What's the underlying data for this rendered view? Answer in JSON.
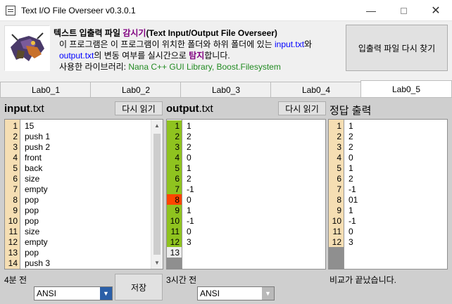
{
  "window": {
    "title": "Text I/O File Overseer v0.3.0.1"
  },
  "header": {
    "line1_a": "텍스트 입출력 파일 ",
    "line1_b": "감시기",
    "line1_c": "(Text Input/Output File Overseer)",
    "line2_a": "이 프로그램은 이 프로그램이 위치한 폴더와 하위 폴더에 있는 ",
    "line2_b": "input.txt",
    "line2_c": "와",
    "line3_a": "output.txt",
    "line3_b": "의 변동 여부를 실시간으로 ",
    "line3_c": "탐지",
    "line3_d": "합니다.",
    "line4_a": "사용한 라이브러리: ",
    "line4_b": "Nana C++ GUI Library, Boost.Filesystem",
    "refind_button": "입출력 파일 다시 찾기"
  },
  "tabs": [
    "Lab0_1",
    "Lab0_2",
    "Lab0_3",
    "Lab0_4",
    "Lab0_5"
  ],
  "active_tab": "Lab0_5",
  "input": {
    "label_bold": "input",
    "label_ext": ".txt",
    "reload_button": "다시 읽기",
    "line_numbers": [
      "1",
      "2",
      "3",
      "4",
      "5",
      "6",
      "7",
      "8",
      "9",
      "10",
      "11",
      "12",
      "13",
      "14"
    ],
    "lines": [
      "15",
      "push 1",
      "push 2",
      "front",
      "back",
      "size",
      "empty",
      "pop",
      "pop",
      "pop",
      "size",
      "empty",
      "pop",
      "push 3"
    ],
    "status": "4분 전",
    "encoding": "ANSI",
    "save_button": "저장"
  },
  "output": {
    "label_bold": "output",
    "label_ext": ".txt",
    "reload_button": "다시 읽기",
    "line_numbers": [
      "1",
      "2",
      "3",
      "4",
      "5",
      "6",
      "7",
      "8",
      "9",
      "10",
      "11",
      "12",
      "13"
    ],
    "lines": [
      "1",
      "2",
      "2",
      "0",
      "1",
      "2",
      "-1",
      "0",
      "1",
      "-1",
      "0",
      "3"
    ],
    "line_states": [
      "ok",
      "ok",
      "ok",
      "ok",
      "ok",
      "ok",
      "ok",
      "wrong",
      "ok",
      "ok",
      "ok",
      "ok",
      "none"
    ],
    "status": "3시간 전",
    "encoding": "ANSI"
  },
  "answer": {
    "label": "정답 출력",
    "line_numbers": [
      "1",
      "2",
      "3",
      "4",
      "5",
      "6",
      "7",
      "8",
      "9",
      "10",
      "11",
      "12"
    ],
    "lines": [
      "1",
      "2",
      "2",
      "0",
      "1",
      "2",
      "-1",
      "01",
      "1",
      "-1",
      "0",
      "3"
    ],
    "status": "비교가 끝났습니다."
  },
  "colors": {
    "ok": "#8fc31f",
    "wrong": "#ff4500",
    "none": "#ededed",
    "answer_gutter": "#f5deb3",
    "input_gutter": "#f5deb3",
    "link": "#0000ff",
    "purple": "#800080",
    "green": "#228b22"
  }
}
